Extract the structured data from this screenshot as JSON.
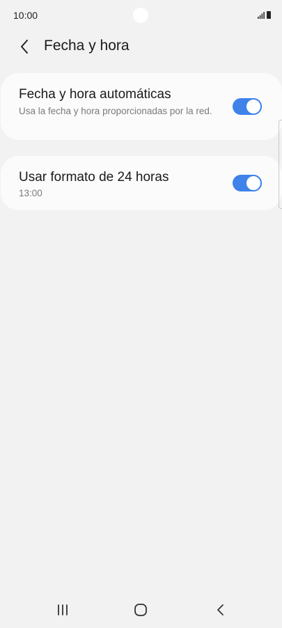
{
  "status_bar": {
    "time": "10:00",
    "icons": [
      "signal-icon",
      "battery-icon"
    ]
  },
  "header": {
    "back_icon": "chevron-left-icon",
    "title": "Fecha y hora"
  },
  "settings": [
    {
      "title": "Fecha y hora automáticas",
      "subtitle": "Usa la fecha y hora proporcionadas por la red.",
      "toggle_on": true
    },
    {
      "title": "Usar formato de 24 horas",
      "subtitle": "13:00",
      "toggle_on": true
    }
  ],
  "nav_bar": {
    "icons": [
      "recents-icon",
      "home-icon",
      "back-icon"
    ]
  },
  "colors": {
    "accent": "#3e82ea",
    "background": "#f2f2f2",
    "card": "#fbfbfb"
  }
}
